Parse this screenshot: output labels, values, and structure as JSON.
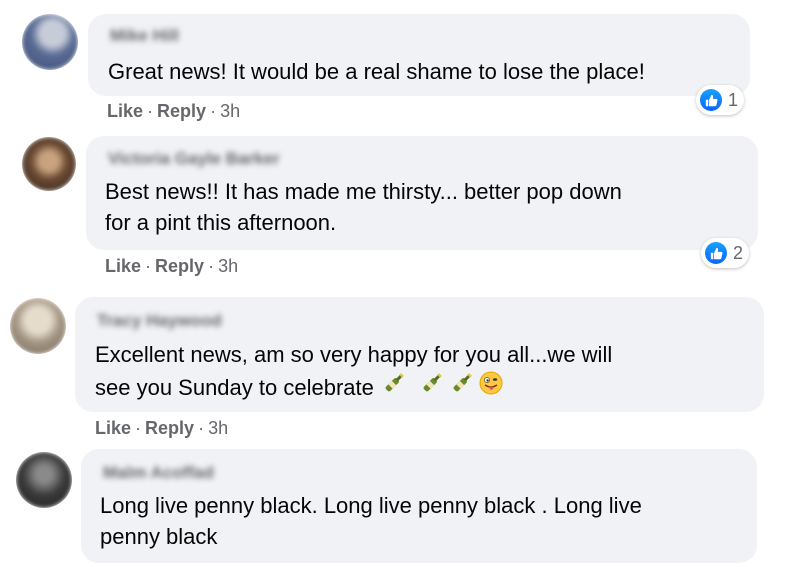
{
  "comments": [
    {
      "author": "Mike Hill",
      "text_lines": [
        "Great news! It would be a real shame to lose the place!"
      ],
      "reaction_count": "1",
      "like": "Like",
      "reply": "Reply",
      "time": "3h"
    },
    {
      "author": "Victoria Gayle Barker",
      "text_lines": [
        "Best news!! It has made me thirsty... better pop down",
        "for a pint this afternoon."
      ],
      "reaction_count": "2",
      "like": "Like",
      "reply": "Reply",
      "time": "3h"
    },
    {
      "author": "Tracy Haywood",
      "text_lines": [
        "Excellent news, am so very happy for you all...we will",
        "see you Sunday to celebrate"
      ],
      "like": "Like",
      "reply": "Reply",
      "time": "3h",
      "emojis": [
        "bottle-emoji",
        "bottle-emoji",
        "bottle-emoji",
        "tongue-face-emoji"
      ]
    },
    {
      "author": "Malm Acoffad",
      "text_lines": [
        "Long live penny black. Long live penny black . Long live",
        "penny black"
      ]
    }
  ],
  "separator": "·",
  "colors": {
    "bubble": "#f0f2f5",
    "secondary_text": "#65676b",
    "like_blue": "#0866ff"
  }
}
